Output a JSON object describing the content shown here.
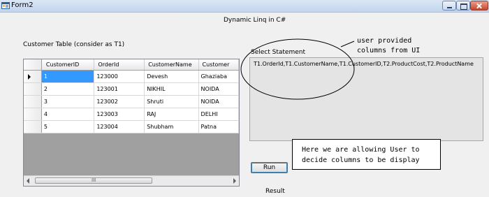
{
  "window": {
    "title": "Form2"
  },
  "heading": "Dynamic Linq in C#",
  "customer_table": {
    "label": "Customer Table (consider as T1)",
    "columns": [
      "CustomerID",
      "OrderId",
      "CustomerName",
      "Customer"
    ],
    "rows": [
      [
        "1",
        "123000",
        "Devesh",
        "Ghaziaba"
      ],
      [
        "2",
        "123001",
        "NIKHIL",
        "NOIDA"
      ],
      [
        "3",
        "123002",
        "Shruti",
        "NOIDA"
      ],
      [
        "4",
        "123003",
        "RAJ",
        "DELHI"
      ],
      [
        "5",
        "123004",
        "Shubham",
        "Patna"
      ]
    ],
    "scroll_grip": "III"
  },
  "select_statement": {
    "label": "Select Statement",
    "value": "T1.OrderId,T1.CustomerName,T1.CustomerID,T2.ProductCost,T2.ProductName"
  },
  "run_button": {
    "label": "Run"
  },
  "result_label": "Result",
  "annotations": {
    "callout_line1": "user provided",
    "callout_line2": "columns from UI",
    "note_line1": "Here we are allowing User to",
    "note_line2": "decide columns to be display"
  },
  "colors": {
    "selection": "#3399ff",
    "textbox_bg": "#e4e4e4",
    "window_bg": "#f0f0f0"
  }
}
